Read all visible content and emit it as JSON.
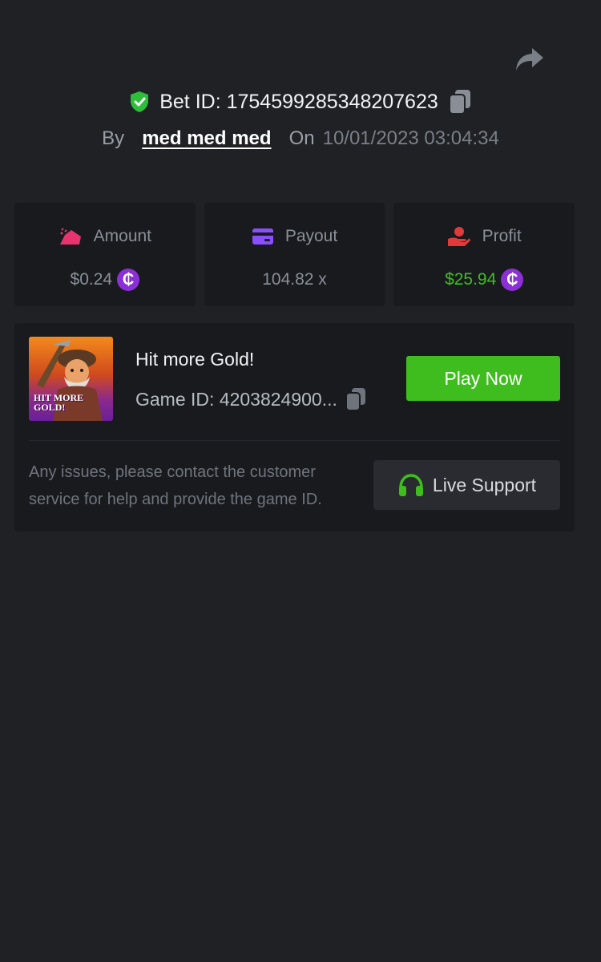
{
  "header": {
    "bet_id_label": "Bet ID:",
    "bet_id": "1754599285348207623",
    "by_label": "By",
    "username": "med med med",
    "on_label": "On",
    "datetime": "10/01/2023 03:04:34"
  },
  "stats": {
    "amount": {
      "label": "Amount",
      "value": "$0.24",
      "icon": "amount-icon"
    },
    "payout": {
      "label": "Payout",
      "value": "104.82 x",
      "icon": "card-icon"
    },
    "profit": {
      "label": "Profit",
      "value": "$25.94",
      "icon": "hand-coin-icon"
    },
    "coin_symbol": "₵"
  },
  "game": {
    "title": "Hit more Gold!",
    "game_id_label": "Game ID:",
    "game_id_short": "4203824900...",
    "thumb_text_line1": "HIT MORE",
    "thumb_text_line2": "GOLD!",
    "play_label": "Play Now"
  },
  "support": {
    "help_text": "Any issues, please contact the customer service for help and provide the game ID.",
    "button_label": "Live Support"
  },
  "colors": {
    "background": "#202125",
    "card": "#191a1e",
    "accent_green": "#3fbd1e",
    "profit_green": "#3bc11f",
    "coin_purple": "#8b2fd6",
    "amount_pink": "#e8336f",
    "payout_purple": "#8a4dff",
    "profit_red": "#e03a3a"
  }
}
